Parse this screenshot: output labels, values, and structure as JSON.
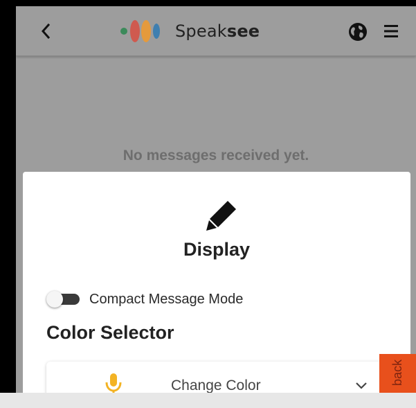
{
  "header": {
    "back_icon": "chevron-left-icon",
    "brand_regular": "Speak",
    "brand_bold": "see",
    "globe_icon": "globe-icon",
    "menu_icon": "hamburger-menu-icon",
    "logo_colors": [
      "#3b8a5a",
      "#cf5a4f",
      "#e59a3c",
      "#3f7fb0"
    ]
  },
  "messages": {
    "empty_text": "No messages received yet."
  },
  "dialog": {
    "icon": "pencil-icon",
    "title": "Display",
    "compact_mode": {
      "label": "Compact Message Mode",
      "enabled": false
    },
    "color_selector": {
      "title": "Color Selector",
      "select_label": "Change Color",
      "icon": "microphone-icon",
      "icon_color": "#f3b324"
    }
  },
  "feedback": {
    "label": "back",
    "color": "#e8501c"
  }
}
